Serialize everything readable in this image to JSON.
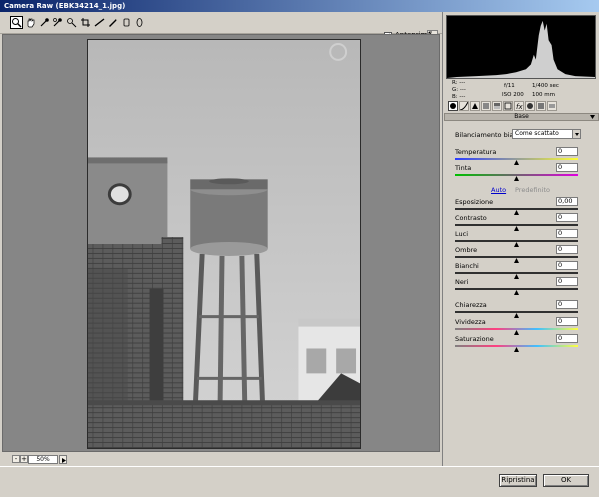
{
  "window": {
    "title": "Camera Raw (EBK34214_1.jpg)"
  },
  "toolbar": {
    "tools": [
      {
        "name": "zoom-icon"
      },
      {
        "name": "hand-icon"
      },
      {
        "name": "white-balance-icon"
      },
      {
        "name": "color-sampler-icon"
      },
      {
        "name": "targeted-adjust-icon"
      },
      {
        "name": "crop-icon"
      },
      {
        "name": "straighten-icon"
      },
      {
        "name": "spot-removal-icon"
      },
      {
        "name": "red-eye-icon"
      },
      {
        "name": "adjustment-brush-icon"
      },
      {
        "name": "graduated-filter-icon"
      }
    ],
    "preview_label": "Anteprima",
    "preview_checked": "✓"
  },
  "status": {
    "zoom": "50%",
    "zoom_minus": "-",
    "zoom_plus": "+"
  },
  "buttons": {
    "reset": "Ripristina",
    "ok": "OK"
  },
  "readout": {
    "r": "R:  ---",
    "g": "G:  ---",
    "b": "B:  ---",
    "aperture": "f/11",
    "shutter": "1/400 sec",
    "iso": "ISO 200",
    "focal": "100 mm"
  },
  "panel": {
    "header": "Base",
    "wb_label": "Bilanciamento bianco:",
    "wb_value": "Come scattato",
    "auto_link": "Auto",
    "default_link": "Predefinito",
    "sliders": [
      {
        "label": "Temperatura",
        "value": "0",
        "pos": 0.5,
        "track": "temperature"
      },
      {
        "label": "Tinta",
        "value": "0",
        "pos": 0.5,
        "track": "tint"
      },
      {
        "label": "Esposizione",
        "value": "0,00",
        "pos": 0.5,
        "track": "gray"
      },
      {
        "label": "Contrasto",
        "value": "0",
        "pos": 0.5,
        "track": "gray"
      },
      {
        "label": "Luci",
        "value": "0",
        "pos": 0.5,
        "track": "gray"
      },
      {
        "label": "Ombre",
        "value": "0",
        "pos": 0.5,
        "track": "gray"
      },
      {
        "label": "Bianchi",
        "value": "0",
        "pos": 0.5,
        "track": "gray"
      },
      {
        "label": "Neri",
        "value": "0",
        "pos": 0.5,
        "track": "gray"
      },
      {
        "label": "Chiarezza",
        "value": "0",
        "pos": 0.5,
        "track": "gray"
      },
      {
        "label": "Vividezza",
        "value": "0",
        "pos": 0.5,
        "track": "color"
      },
      {
        "label": "Saturazione",
        "value": "0",
        "pos": 0.5,
        "track": "color"
      }
    ]
  },
  "colors": {
    "title_start": "#0a246a",
    "title_end": "#a6caf0",
    "canvas_bg": "#868686",
    "panel_bg": "#d4d0c8",
    "link": "#0000cc"
  }
}
